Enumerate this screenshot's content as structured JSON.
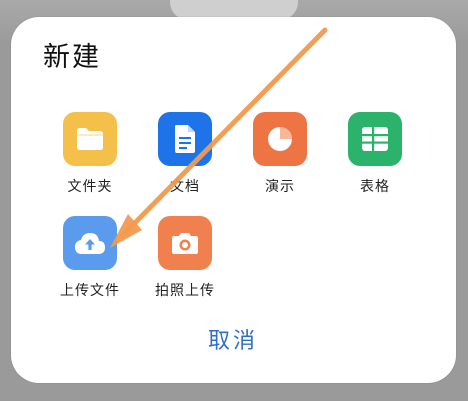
{
  "dialog": {
    "title": "新建",
    "cancel_label": "取消"
  },
  "items": [
    {
      "key": "folder",
      "label": "文件夹",
      "icon": "folder-icon",
      "color": "#F5C04A"
    },
    {
      "key": "document",
      "label": "文档",
      "icon": "document-icon",
      "color": "#1E73E8"
    },
    {
      "key": "presentation",
      "label": "演示",
      "icon": "pie-chart-icon",
      "color": "#EF7444"
    },
    {
      "key": "spreadsheet",
      "label": "表格",
      "icon": "table-icon",
      "color": "#2CB36B"
    },
    {
      "key": "upload",
      "label": "上传文件",
      "icon": "cloud-upload-icon",
      "color": "#5A9BEE"
    },
    {
      "key": "photo-upload",
      "label": "拍照上传",
      "icon": "camera-icon",
      "color": "#F0814F"
    }
  ],
  "colors": {
    "accent": "#2F6FC9",
    "annotation_arrow": "#F29A4E"
  }
}
